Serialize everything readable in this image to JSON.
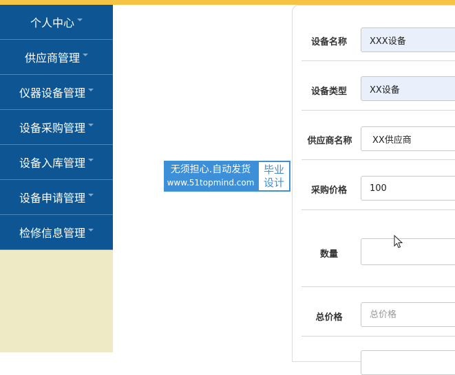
{
  "sidebar": {
    "items": [
      {
        "label": "个人中心"
      },
      {
        "label": "供应商管理"
      },
      {
        "label": "仪器设备管理"
      },
      {
        "label": "设备采购管理"
      },
      {
        "label": "设备入库管理"
      },
      {
        "label": "设备申请管理"
      },
      {
        "label": "检修信息管理"
      }
    ]
  },
  "banner": {
    "line1": "无须担心.自动发货",
    "line2": "www.51topmind.com",
    "side1": "毕业",
    "side2": "设计"
  },
  "form": {
    "device_name": {
      "label": "设备名称",
      "value": "XXX设备"
    },
    "device_type": {
      "label": "设备类型",
      "value": "XX设备"
    },
    "supplier_name": {
      "label": "供应商名称",
      "value": "XX供应商"
    },
    "purchase_price": {
      "label": "采购价格",
      "value": "100"
    },
    "quantity": {
      "label": "数量",
      "value": ""
    },
    "total_price": {
      "label": "总价格",
      "placeholder": "总价格"
    }
  },
  "colors": {
    "topbar": "#f5c445",
    "sidebar_item": "#0d5593",
    "sidebar_bg": "#efeac6",
    "banner": "#3d8fd8"
  }
}
